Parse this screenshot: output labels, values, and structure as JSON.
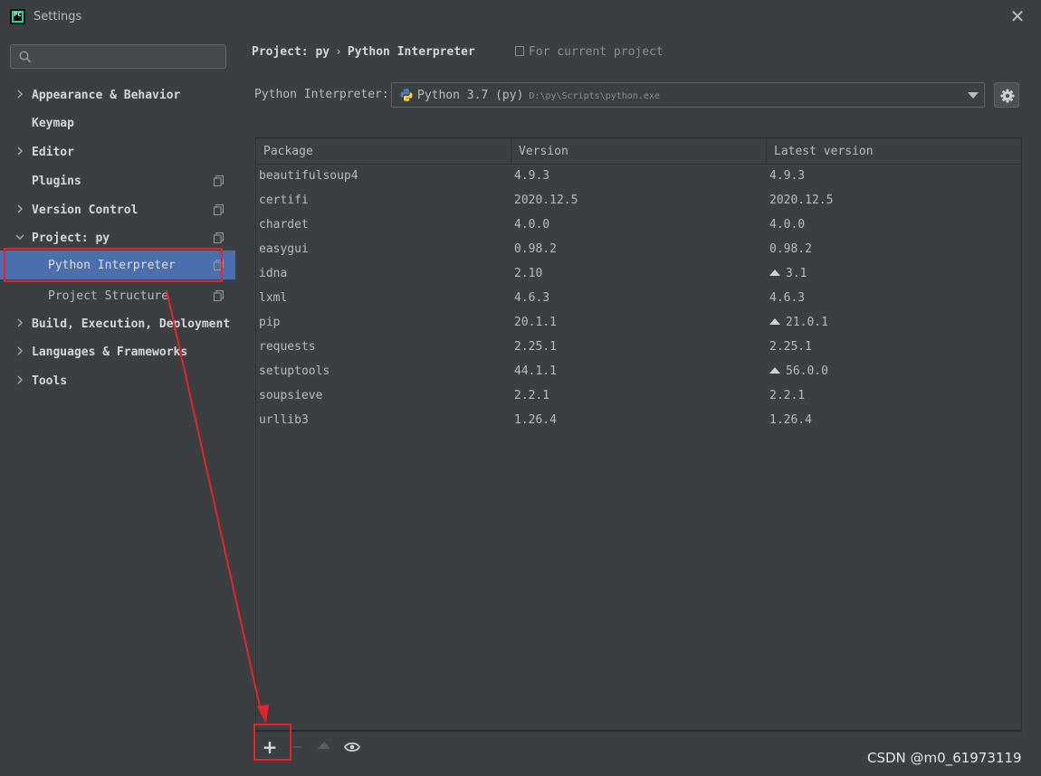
{
  "window": {
    "title": "Settings",
    "app_logo_text": "PC",
    "close_glyph": "✕"
  },
  "sidebar": {
    "search": {
      "placeholder": "",
      "value": ""
    },
    "items": [
      {
        "label": "Appearance & Behavior",
        "chevron": ">",
        "level": 0
      },
      {
        "label": "Keymap",
        "chevron": "",
        "level": 0
      },
      {
        "label": "Editor",
        "chevron": ">",
        "level": 0
      },
      {
        "label": "Plugins",
        "chevron": "",
        "level": 0,
        "copy_icon": true
      },
      {
        "label": "Version Control",
        "chevron": ">",
        "level": 0,
        "copy_icon": true
      },
      {
        "label": "Project: py",
        "chevron": "v",
        "level": 0,
        "copy_icon": true
      },
      {
        "label": "Python Interpreter",
        "chevron": "",
        "level": 1,
        "copy_icon": true,
        "selected": true
      },
      {
        "label": "Project Structure",
        "chevron": "",
        "level": 1,
        "copy_icon": true
      },
      {
        "label": "Build, Execution, Deployment",
        "chevron": ">",
        "level": 0
      },
      {
        "label": "Languages & Frameworks",
        "chevron": ">",
        "level": 0
      },
      {
        "label": "Tools",
        "chevron": ">",
        "level": 0
      }
    ]
  },
  "breadcrumb": {
    "project": "Project: py",
    "separator": "›",
    "page": "Python Interpreter"
  },
  "scope_note": "For current project",
  "interpreter": {
    "label": "Python Interpreter:",
    "name": "Python 3.7 (py)",
    "path": "D:\\py\\Scripts\\python.exe"
  },
  "table": {
    "headers": [
      "Package",
      "Version",
      "Latest version"
    ],
    "rows": [
      {
        "package": "beautifulsoup4",
        "version": "4.9.3",
        "latest": "4.9.3",
        "upgrade": false
      },
      {
        "package": "certifi",
        "version": "2020.12.5",
        "latest": "2020.12.5",
        "upgrade": false
      },
      {
        "package": "chardet",
        "version": "4.0.0",
        "latest": "4.0.0",
        "upgrade": false
      },
      {
        "package": "easygui",
        "version": "0.98.2",
        "latest": "0.98.2",
        "upgrade": false
      },
      {
        "package": "idna",
        "version": "2.10",
        "latest": "3.1",
        "upgrade": true
      },
      {
        "package": "lxml",
        "version": "4.6.3",
        "latest": "4.6.3",
        "upgrade": false
      },
      {
        "package": "pip",
        "version": "20.1.1",
        "latest": "21.0.1",
        "upgrade": true
      },
      {
        "package": "requests",
        "version": "2.25.1",
        "latest": "2.25.1",
        "upgrade": false
      },
      {
        "package": "setuptools",
        "version": "44.1.1",
        "latest": "56.0.0",
        "upgrade": true
      },
      {
        "package": "soupsieve",
        "version": "2.2.1",
        "latest": "2.2.1",
        "upgrade": false
      },
      {
        "package": "urllib3",
        "version": "1.26.4",
        "latest": "1.26.4",
        "upgrade": false
      }
    ]
  },
  "toolbar": {
    "add": "+",
    "remove": "−"
  },
  "watermark": "CSDN @m0_61973119",
  "colors": {
    "background": "#3c3f41",
    "selection": "#4b6eaf",
    "annotation": "#e4232a"
  }
}
